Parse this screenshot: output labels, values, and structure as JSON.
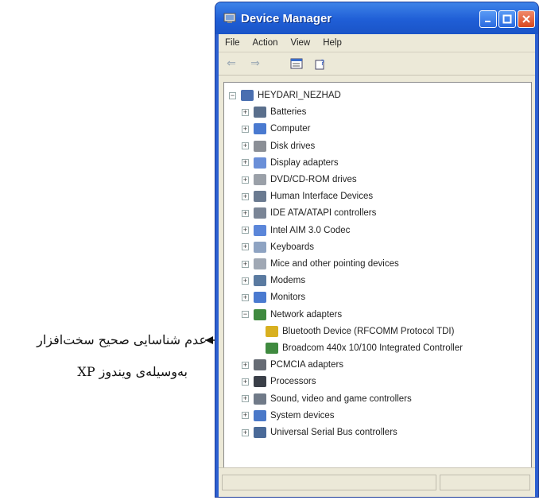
{
  "window": {
    "title": "Device Manager",
    "colors": {
      "titlebar": "#1f5ed6",
      "client": "#ece9d8",
      "close": "#d8481f"
    }
  },
  "menu": [
    "File",
    "Action",
    "View",
    "Help"
  ],
  "toolbar": {
    "icons": [
      "back-arrow-icon",
      "forward-arrow-icon",
      "properties-icon",
      "help-icon"
    ]
  },
  "tree": {
    "root": "HEYDARI_NEZHAD",
    "categories": [
      {
        "label": "Batteries",
        "expanded": false,
        "icon": "battery-icon"
      },
      {
        "label": "Computer",
        "expanded": false,
        "icon": "computer-icon"
      },
      {
        "label": "Disk drives",
        "expanded": false,
        "icon": "disk-drive-icon"
      },
      {
        "label": "Display adapters",
        "expanded": false,
        "icon": "display-adapter-icon"
      },
      {
        "label": "DVD/CD-ROM drives",
        "expanded": false,
        "icon": "dvd-drive-icon"
      },
      {
        "label": "Human Interface Devices",
        "expanded": false,
        "icon": "hid-icon"
      },
      {
        "label": "IDE ATA/ATAPI controllers",
        "expanded": false,
        "icon": "ide-controller-icon"
      },
      {
        "label": "Intel AIM 3.0 Codec",
        "expanded": false,
        "icon": "codec-icon"
      },
      {
        "label": "Keyboards",
        "expanded": false,
        "icon": "keyboard-icon"
      },
      {
        "label": "Mice and other pointing devices",
        "expanded": false,
        "icon": "mouse-icon"
      },
      {
        "label": "Modems",
        "expanded": false,
        "icon": "modem-icon"
      },
      {
        "label": "Monitors",
        "expanded": false,
        "icon": "monitor-icon"
      },
      {
        "label": "Network adapters",
        "expanded": true,
        "icon": "network-adapter-icon",
        "children": [
          {
            "label": "Bluetooth Device (RFCOMM Protocol TDI)",
            "icon": "warning-device-icon"
          },
          {
            "label": "Broadcom 440x 10/100 Integrated Controller",
            "icon": "network-card-icon"
          }
        ]
      },
      {
        "label": "PCMCIA adapters",
        "expanded": false,
        "icon": "pcmcia-icon"
      },
      {
        "label": "Processors",
        "expanded": false,
        "icon": "processor-icon"
      },
      {
        "label": "Sound, video and game controllers",
        "expanded": false,
        "icon": "sound-icon"
      },
      {
        "label": "System devices",
        "expanded": false,
        "icon": "system-devices-icon"
      },
      {
        "label": "Universal Serial Bus controllers",
        "expanded": false,
        "icon": "usb-icon"
      }
    ]
  },
  "annotation": {
    "line1": "عدم شناسایی صحیح سخت‌افزار",
    "line2": "به‌وسیله‌ی ویندوز XP"
  }
}
